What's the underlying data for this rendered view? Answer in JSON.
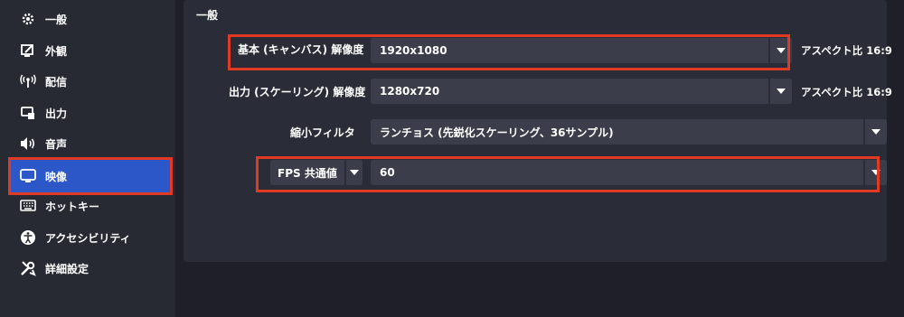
{
  "sidebar": {
    "items": [
      {
        "label": "一般",
        "icon": "gear-icon"
      },
      {
        "label": "外観",
        "icon": "appearance-icon"
      },
      {
        "label": "配信",
        "icon": "broadcast-icon"
      },
      {
        "label": "出力",
        "icon": "output-icon"
      },
      {
        "label": "音声",
        "icon": "speaker-icon"
      },
      {
        "label": "映像",
        "icon": "monitor-icon"
      },
      {
        "label": "ホットキー",
        "icon": "keyboard-icon"
      },
      {
        "label": "アクセシビリティ",
        "icon": "accessibility-icon"
      },
      {
        "label": "詳細設定",
        "icon": "tools-icon"
      }
    ],
    "active_index": 5
  },
  "panel": {
    "section_title": "一般",
    "base_resolution": {
      "label": "基本 (キャンバス) 解像度",
      "value": "1920x1080",
      "aspect_prefix": "アスペクト比",
      "aspect_value": "16:9"
    },
    "output_resolution": {
      "label": "出力 (スケーリング) 解像度",
      "value": "1280x720",
      "aspect_prefix": "アスペクト比",
      "aspect_value": "16:9"
    },
    "downscale_filter": {
      "label": "縮小フィルタ",
      "value": "ランチョス (先鋭化スケーリング、36サンプル)"
    },
    "fps": {
      "type_label": "FPS 共通値",
      "value": "60"
    }
  },
  "colors": {
    "accent": "#2b57c9",
    "highlight": "#e03a22",
    "sidebar_bg": "#272a33",
    "panel_bg": "#2a2d38",
    "combo_bg": "#3b3e4a"
  }
}
